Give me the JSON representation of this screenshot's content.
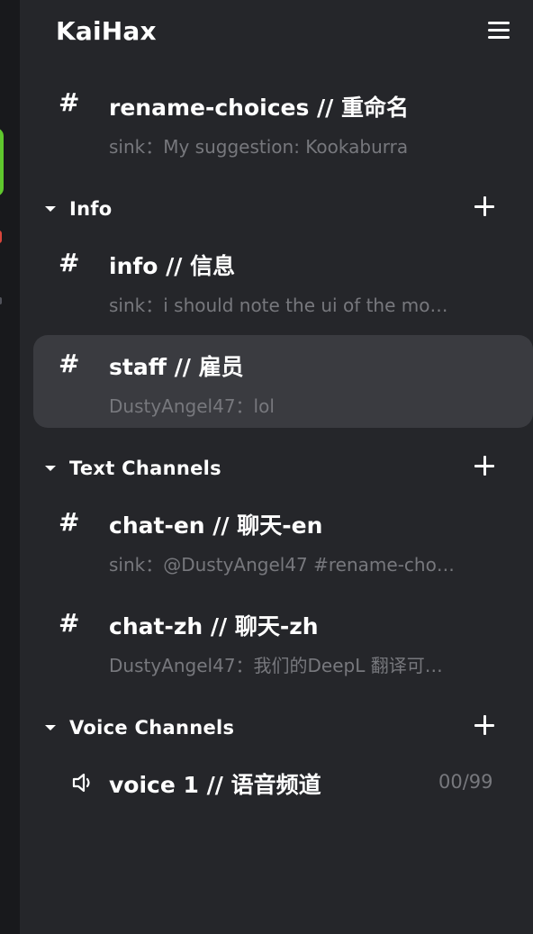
{
  "server": {
    "name": "KaiHax"
  },
  "channels_top": [
    {
      "name": "rename-choices // 重命名",
      "preview": "sink：My suggestion: Kookaburra"
    }
  ],
  "categories": [
    {
      "label": "Info",
      "channels": [
        {
          "name": "info // 信息",
          "preview": "sink：i should note the ui of the mo…"
        },
        {
          "name": "staff // 雇员",
          "preview": "DustyAngel47：lol",
          "active": true
        }
      ]
    },
    {
      "label": "Text Channels",
      "channels": [
        {
          "name": "chat-en // 聊天-en",
          "preview": "sink：@DustyAngel47 #rename-cho…"
        },
        {
          "name": "chat-zh // 聊天-zh",
          "preview": "DustyAngel47：我们的DeepL 翻译可…"
        }
      ]
    },
    {
      "label": "Voice Channels",
      "voice_channels": [
        {
          "name": "voice 1 // 语音频道",
          "count": "00/99"
        }
      ]
    }
  ],
  "icons": {
    "menu": "hamburger-icon",
    "hash": "#",
    "collapse": "caret-down-icon",
    "add": "plus-icon",
    "voice": "speaker-icon"
  },
  "colors": {
    "panel_bg": "#25262a",
    "active_bg": "#3a3b40",
    "muted_text": "#77787d",
    "status_online": "#5fc82d"
  }
}
